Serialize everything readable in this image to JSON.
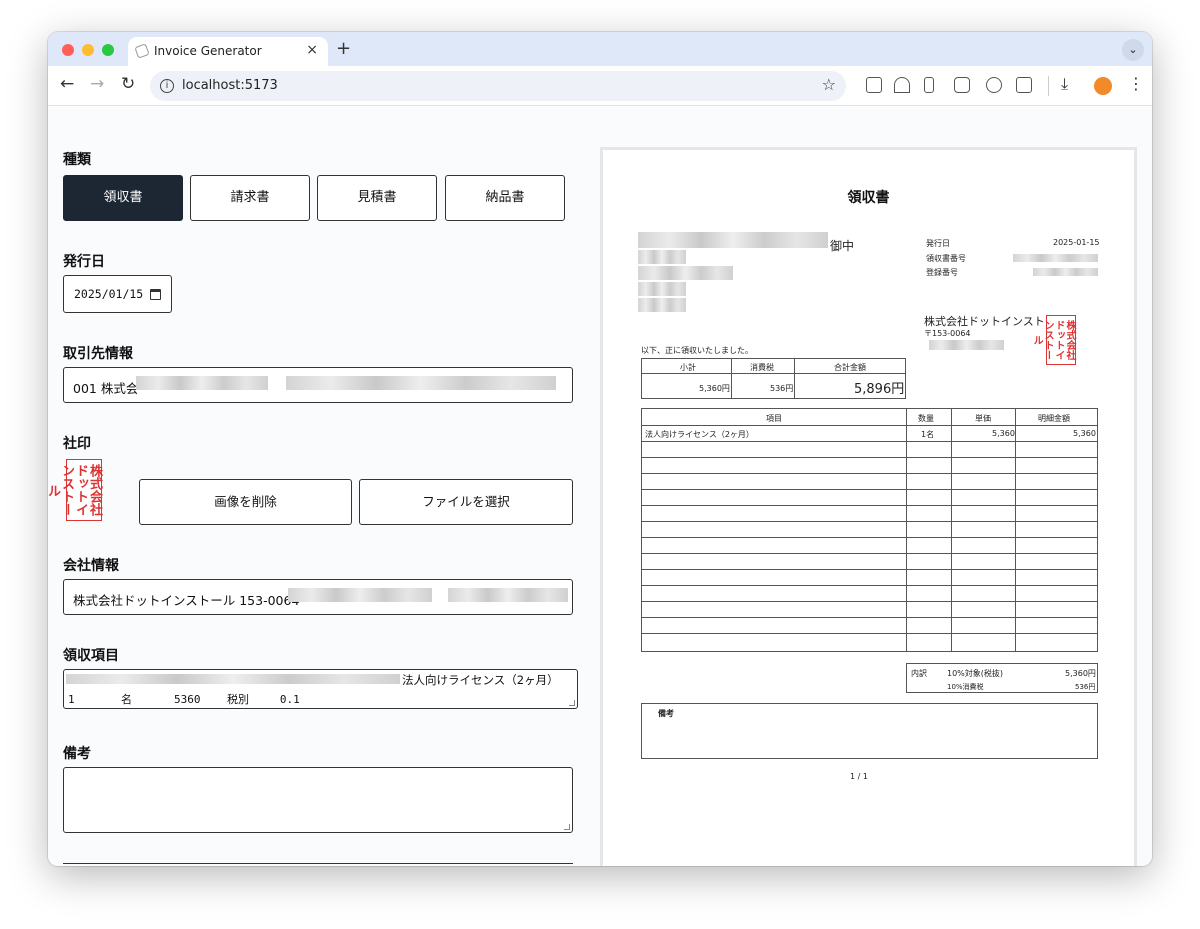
{
  "browser": {
    "tab_title": "Invoice Generator",
    "new_tab": "+",
    "tab_close": "×",
    "tab_search": "⌄",
    "url": "localhost:5173",
    "back": "←",
    "forward": "→",
    "reload": "↻",
    "star": "☆",
    "download": "⤓",
    "menu": "⋮"
  },
  "form": {
    "type_label": "種類",
    "types": [
      "領収書",
      "請求書",
      "見積書",
      "納品書"
    ],
    "active_type": "領収書",
    "issue_date_label": "発行日",
    "issue_date_value": "2025/01/15",
    "client_label": "取引先情報",
    "client_value_prefix": "001  株式会",
    "seal_label": "社印",
    "seal_text": "株式会社ドットインストール",
    "delete_image_button": "画像を削除",
    "choose_file_button": "ファイルを選択",
    "company_label": "会社情報",
    "company_value_prefix": "株式会社ドットインストール 153-0064",
    "items_label": "領収項目",
    "items_line1_suffix": "法人向けライセンス（2ヶ月）",
    "items_line2": "1\t名\t5360\t税別\t0.1",
    "notes_label": "備考",
    "notes_value": ""
  },
  "preview": {
    "title": "領収書",
    "recipient_suffix": "御中",
    "issue_date_label": "発行日",
    "issue_date_value": "2025-01-15",
    "receipt_no_label": "領収書番号",
    "registration_no_label": "登録番号",
    "issuer_name": "株式会社ドットインストール",
    "issuer_postal": "〒153-0064",
    "received_text": "以下、正に領収いたしました。",
    "summary": {
      "subtotal_label": "小計",
      "tax_label": "消費税",
      "total_label": "合計金額",
      "subtotal": "5,360円",
      "tax": "536円",
      "total": "5,896円"
    },
    "items_header": [
      "項目",
      "数量",
      "単価",
      "明細金額"
    ],
    "items": [
      {
        "name": "法人向けライセンス（2ヶ月）",
        "qty": "1名",
        "unit_price": "5,360",
        "amount": "5,360"
      }
    ],
    "breakdown": {
      "label": "内訳",
      "target_label": "10%対象(税抜)",
      "target_value": "5,360円",
      "tax_label": "10%消費税",
      "tax_value": "536円"
    },
    "notes_label": "備考",
    "page_indicator": "1 / 1"
  }
}
